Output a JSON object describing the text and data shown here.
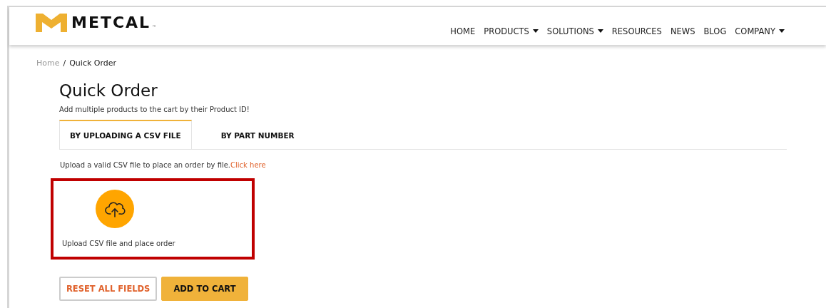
{
  "logo": {
    "text": "METCAL",
    "mark": "™"
  },
  "nav": [
    {
      "label": "HOME",
      "dropdown": false
    },
    {
      "label": "PRODUCTS",
      "dropdown": true
    },
    {
      "label": "SOLUTIONS",
      "dropdown": true
    },
    {
      "label": "RESOURCES",
      "dropdown": false
    },
    {
      "label": "NEWS",
      "dropdown": false
    },
    {
      "label": "BLOG",
      "dropdown": false
    },
    {
      "label": "COMPANY",
      "dropdown": true
    }
  ],
  "breadcrumb": {
    "links": [
      "Home"
    ],
    "separator": "/",
    "current": "Quick Order"
  },
  "title": "Quick Order",
  "subtitle": "Add multiple products to the cart by their Product ID!",
  "tabs": [
    {
      "label": "BY UPLOADING A CSV FILE",
      "selected": true
    },
    {
      "label": "BY PART NUMBER",
      "selected": false
    }
  ],
  "upload_hint": {
    "text": "Upload a valid CSV file to place an order by file.",
    "link": "Click here"
  },
  "upload": {
    "caption": "Upload CSV file and place order",
    "highlighted": true
  },
  "buttons": [
    {
      "label": "RESET ALL FIELDS",
      "kind": "outline"
    },
    {
      "label": "ADD TO CART",
      "kind": "primary"
    }
  ]
}
